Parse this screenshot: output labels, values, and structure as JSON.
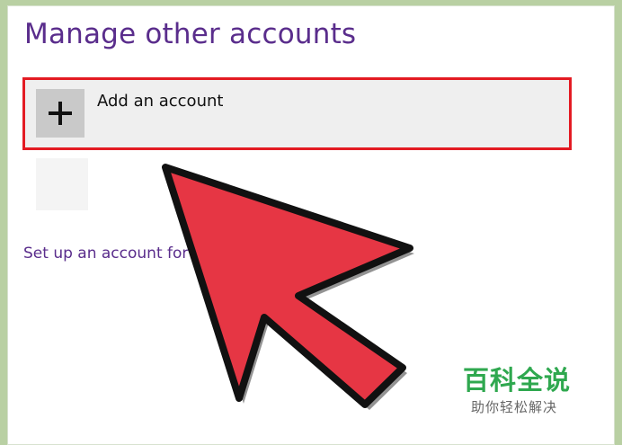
{
  "header": {
    "title": "Manage other accounts"
  },
  "add_account": {
    "label": "Add an account",
    "icon": "plus-icon"
  },
  "setup_link": {
    "text": "Set up an account for"
  },
  "overlay": {
    "arrow_color": "#e63644",
    "highlight_color": "#e31b23"
  },
  "watermark": {
    "main": "百科全说",
    "sub": "助你轻松解决"
  }
}
